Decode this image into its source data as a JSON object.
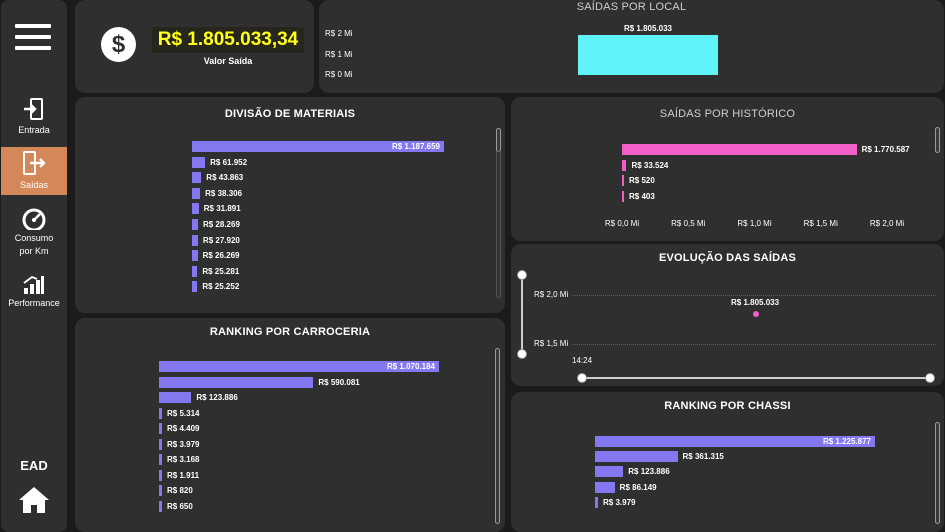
{
  "sidebar": {
    "nav": [
      {
        "label": "Entrada",
        "icon": "entrada-icon"
      },
      {
        "label": "Saídas",
        "icon": "saidas-icon"
      },
      {
        "label": "Consumo por Km",
        "icon": "speedometer-icon"
      },
      {
        "label": "Performance",
        "icon": "performance-icon"
      }
    ],
    "active_label": "Saídas",
    "footer_label": "EAD",
    "active_color": "#d4885a"
  },
  "kpi": {
    "value": "R$ 1.805.033,34",
    "label": "Valor Saída",
    "icon": "dollar-icon",
    "value_color": "#ffff1a"
  },
  "panels": {
    "local": "SAÍDAS POR LOCAL",
    "materiais": "DIVISÃO DE MATERIAIS",
    "historico": "SAÍDAS POR HISTÓRICO",
    "evolucao": "EVOLUÇÃO DAS SAÍDAS",
    "carroceria": "RANKING POR CARROCERIA",
    "chassi": "RANKING POR CHASSI"
  },
  "chart_data": [
    {
      "id": "local",
      "type": "bar",
      "title": "SAÍDAS POR LOCAL",
      "y_ticks": [
        "R$ 2 Mi",
        "R$ 1 Mi",
        "R$ 0 Mi"
      ],
      "values": [
        1805033
      ],
      "value_labels": [
        "R$ 1.805.033"
      ],
      "ylim": [
        0,
        2000000
      ],
      "color": "#5ff3f7"
    },
    {
      "id": "materiais",
      "type": "bar",
      "orientation": "horizontal",
      "title": "DIVISÃO DE MATERIAIS",
      "values": [
        1187659,
        61952,
        43863,
        38306,
        31891,
        28269,
        27920,
        26269,
        25281,
        25252
      ],
      "value_labels": [
        "R$ 1.187.659",
        "R$ 61.952",
        "R$ 43.863",
        "R$ 38.306",
        "R$ 31.891",
        "R$ 28.269",
        "R$ 27.920",
        "R$ 26.269",
        "R$ 25.281",
        "R$ 25.252"
      ],
      "color": "#8478f0"
    },
    {
      "id": "historico",
      "type": "bar",
      "orientation": "horizontal",
      "title": "SAÍDAS POR HISTÓRICO",
      "values": [
        1770587,
        33524,
        520,
        403
      ],
      "value_labels": [
        "R$ 1.770.587",
        "R$ 33.524",
        "R$ 520",
        "R$ 403"
      ],
      "x_ticks": [
        "R$ 0,0 Mi",
        "R$ 0,5 Mi",
        "R$ 1,0 Mi",
        "R$ 1,5 Mi",
        "R$ 2,0 Mi"
      ],
      "xlim": [
        0,
        2000000
      ],
      "color": "#f25fc6"
    },
    {
      "id": "evolucao",
      "type": "scatter",
      "title": "EVOLUÇÃO DAS SAÍDAS",
      "x": [
        "14:24"
      ],
      "y": [
        1805033
      ],
      "value_labels": [
        "R$ 1.805.033"
      ],
      "y_ticks": [
        "R$ 2,0 Mi",
        "R$ 1,5 Mi"
      ],
      "ylim": [
        1500000,
        2000000
      ],
      "x_tick": "14:24",
      "color": "#f25fc6"
    },
    {
      "id": "carroceria",
      "type": "bar",
      "orientation": "horizontal",
      "title": "RANKING POR CARROCERIA",
      "values": [
        1070184,
        590081,
        123886,
        5314,
        4409,
        3979,
        3168,
        1911,
        820,
        650
      ],
      "value_labels": [
        "R$ 1.070.184",
        "R$ 590.081",
        "R$ 123.886",
        "R$ 5.314",
        "R$ 4.409",
        "R$ 3.979",
        "R$ 3.168",
        "R$ 1.911",
        "R$ 820",
        "R$ 650"
      ],
      "color": "#8478f0"
    },
    {
      "id": "chassi",
      "type": "bar",
      "orientation": "horizontal",
      "title": "RANKING POR CHASSI",
      "values": [
        1225877,
        361315,
        123886,
        86149,
        3979
      ],
      "value_labels": [
        "R$ 1.225.877",
        "R$ 361.315",
        "R$ 123.886",
        "R$ 86.149",
        "R$ 3.979"
      ],
      "color": "#8478f0"
    }
  ]
}
